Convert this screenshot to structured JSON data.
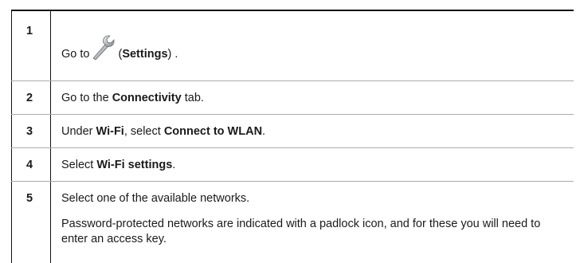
{
  "steps": [
    {
      "number": "1",
      "text_before": "Go to",
      "icon": "wrench-settings-icon",
      "paren_open": "(",
      "bold": "Settings",
      "paren_close": ") ."
    },
    {
      "number": "2",
      "text_before": "Go to the ",
      "bold": "Connectivity",
      "text_after": " tab."
    },
    {
      "number": "3",
      "text_before": "Under ",
      "bold1": "Wi-Fi",
      "text_mid": ", select ",
      "bold2": "Connect to WLAN",
      "text_after": "."
    },
    {
      "number": "4",
      "text_before": "Select ",
      "bold": "Wi-Fi settings",
      "text_after": "."
    },
    {
      "number": "5",
      "text": "Select one of the available networks.",
      "note": "Password-protected networks are indicated with a padlock icon, and for these you will need to enter an access key."
    }
  ]
}
